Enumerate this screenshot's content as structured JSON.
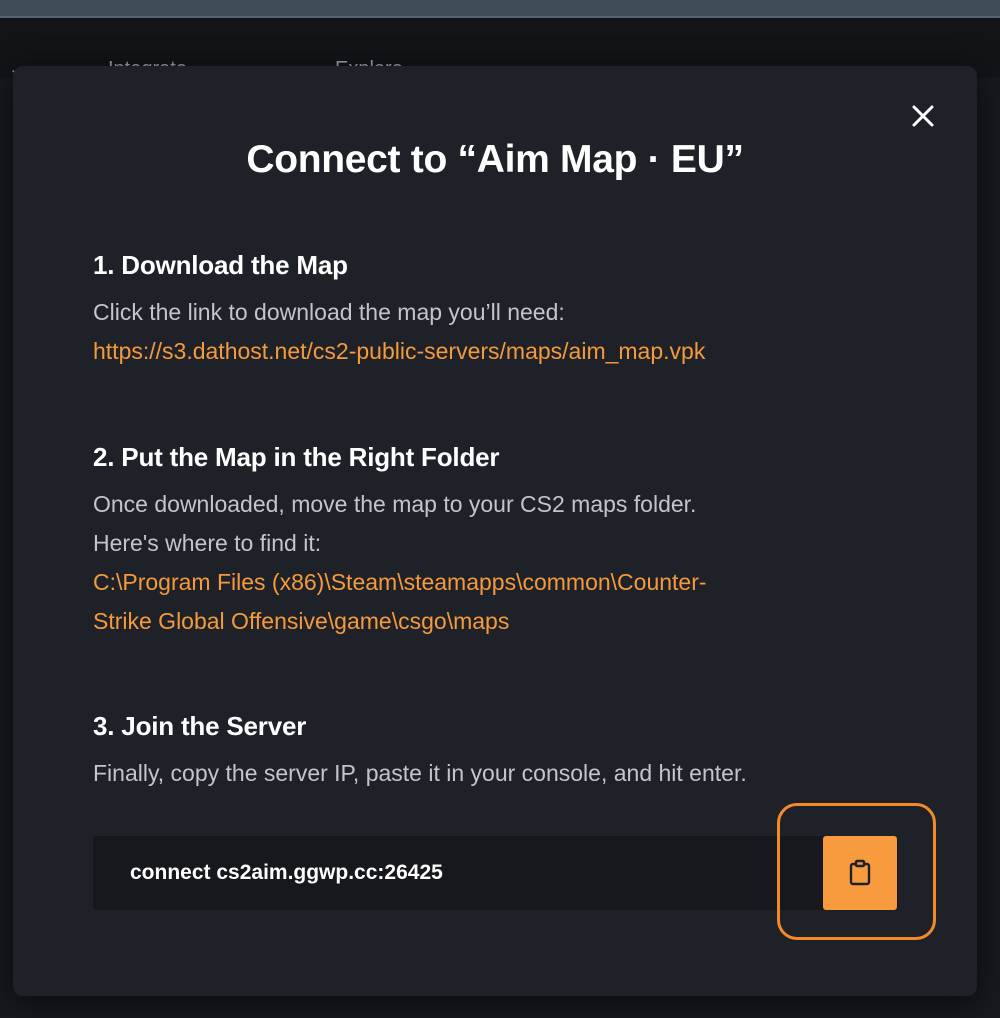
{
  "background": {
    "nav_items": [
      "Integrate ⌄",
      "Explore ⌄"
    ]
  },
  "modal": {
    "title": "Connect to “Aim Map · EU”",
    "sections": [
      {
        "heading": "1. Download the Map",
        "text": "Click the link to download the map you’ll need:",
        "link": "https://s3.dathost.net/cs2-public-servers/maps/aim_map.vpk"
      },
      {
        "heading": "2. Put the Map in the Right Folder",
        "text_line1": "Once downloaded, move the map to your CS2 maps folder.",
        "text_line2": "Here's where to find it:",
        "path_line1": "C:\\Program Files (x86)\\Steam\\steamapps\\common\\Counter-",
        "path_line2": "Strike Global Offensive\\game\\csgo\\maps"
      },
      {
        "heading": "3. Join the Server",
        "text": "Finally, copy the server IP, paste it in your console, and hit enter."
      }
    ],
    "connect_command": "connect cs2aim.ggwp.cc:26425",
    "icons": {
      "close": "close-icon",
      "copy": "clipboard-icon"
    }
  },
  "colors": {
    "accent": "#f89b3f",
    "link": "#f59a3c",
    "modal_bg": "#1f2128",
    "ip_box_bg": "#16181d",
    "highlight": "#f38a2a"
  }
}
